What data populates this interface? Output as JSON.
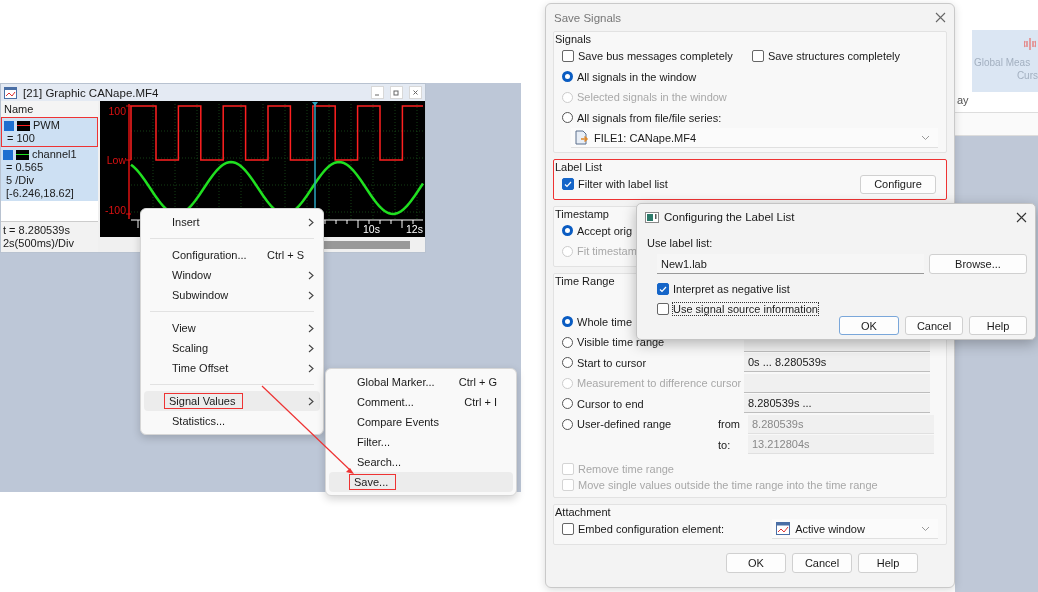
{
  "graphic_window": {
    "title": "[21] Graphic CANape.MF4",
    "column_header": "Name",
    "signals": [
      {
        "name": "PWM",
        "value": "= 100",
        "checked": true,
        "color": "#ff2020",
        "annotated": true
      },
      {
        "name": "channel1",
        "value": "= 0.565",
        "checked": true,
        "color": "#20e020",
        "annotated": false,
        "details": [
          "5  /Div",
          "[-6.246,18.62]"
        ]
      }
    ],
    "y_labels": [
      "100",
      "Low",
      "-100"
    ],
    "x_labels": [
      "10s",
      "12s"
    ],
    "status": [
      "t = 8.280539s",
      "2s(500ms)/Div"
    ]
  },
  "context_menu": {
    "groups": [
      [
        {
          "label": "Insert",
          "submenu": true,
          "highlighted": false,
          "annotated": false
        }
      ],
      [
        {
          "label": "Configuration...",
          "shortcut": "Ctrl + S",
          "submenu": false,
          "highlighted": false,
          "annotated": false
        },
        {
          "label": "Window",
          "submenu": true,
          "highlighted": false,
          "annotated": false
        },
        {
          "label": "Subwindow",
          "submenu": true,
          "highlighted": false,
          "annotated": false
        }
      ],
      [
        {
          "label": "View",
          "submenu": true,
          "highlighted": false,
          "annotated": false
        },
        {
          "label": "Scaling",
          "submenu": true,
          "highlighted": false,
          "annotated": false
        },
        {
          "label": "Time Offset",
          "submenu": true,
          "highlighted": false,
          "annotated": false
        }
      ],
      [
        {
          "label": "Signal Values",
          "submenu": true,
          "highlighted": true,
          "annotated": true
        },
        {
          "label": "Statistics...",
          "submenu": false,
          "highlighted": false,
          "annotated": false
        }
      ]
    ]
  },
  "submenu": {
    "items": [
      {
        "label": "Global Marker...",
        "shortcut": "Ctrl + G",
        "highlighted": false,
        "annotated": false
      },
      {
        "label": "Comment...",
        "shortcut": "Ctrl + I",
        "highlighted": false,
        "annotated": false
      },
      {
        "label": "Compare Events",
        "highlighted": false,
        "annotated": false
      },
      {
        "label": "Filter...",
        "highlighted": false,
        "annotated": false
      },
      {
        "label": "Search...",
        "highlighted": false,
        "annotated": false
      },
      {
        "label": "Save...",
        "highlighted": true,
        "annotated": true
      }
    ]
  },
  "background_app": {
    "ribbon_button": [
      "Global Meas",
      "Curs"
    ],
    "side_label": "ay"
  },
  "save_dialog": {
    "title": "Save Signals",
    "signals": {
      "title": "Signals",
      "checkboxes": [
        {
          "label": "Save bus messages completely",
          "checked": false
        },
        {
          "label": "Save structures completely",
          "checked": false
        }
      ],
      "radios": [
        {
          "label": "All signals in the window",
          "selected": true,
          "disabled": false
        },
        {
          "label": "Selected signals in the window",
          "selected": false,
          "disabled": true
        },
        {
          "label": "All signals from file/file series:",
          "selected": false,
          "disabled": false
        }
      ],
      "file_dropdown": "FILE1: CANape.MF4"
    },
    "label_list": {
      "title": "Label List",
      "annotated": true,
      "checkbox": {
        "label": "Filter with label list",
        "checked": true
      },
      "button": "Configure"
    },
    "timestamp": {
      "title": "Timestamp",
      "radios": [
        {
          "label": "Accept orig",
          "selected": true,
          "disabled": false
        },
        {
          "label": "Fit timestam",
          "selected": false,
          "disabled": true
        }
      ]
    },
    "time_range": {
      "title": "Time Range",
      "options": [
        {
          "label": "Whole time",
          "selected": true,
          "disabled": false,
          "kind": "plain"
        },
        {
          "label": "Visible time range",
          "selected": false,
          "disabled": false,
          "kind": "field"
        },
        {
          "label": "Start to cursor",
          "selected": false,
          "disabled": false,
          "kind": "field",
          "value": "0s  ...  8.280539s"
        },
        {
          "label": "Measurement to difference cursor",
          "selected": false,
          "disabled": true,
          "kind": "field"
        },
        {
          "label": "Cursor to end",
          "selected": false,
          "disabled": false,
          "kind": "field",
          "value": "8.280539s  ..."
        },
        {
          "label": "User-defined range",
          "selected": false,
          "disabled": false,
          "kind": "range",
          "from_label": "from",
          "from_value": "8.280539s",
          "to_label": "to:",
          "to_value": "13.212804s"
        }
      ],
      "checkboxes": [
        {
          "label": "Remove time range",
          "checked": false,
          "disabled": true
        },
        {
          "label": "Move single values outside the time range into the time range",
          "checked": false,
          "disabled": true
        }
      ]
    },
    "attachment": {
      "title": "Attachment",
      "checkbox": {
        "label": "Embed configuration element:",
        "checked": false
      },
      "dropdown": "Active window"
    },
    "buttons": [
      "OK",
      "Cancel",
      "Help"
    ]
  },
  "label_dialog": {
    "title": "Configuring the Label List",
    "field_label": "Use label list:",
    "file": "New1.lab",
    "browse": "Browse...",
    "checkboxes": [
      {
        "label": "Interpret as negative list",
        "checked": true,
        "focused": false
      },
      {
        "label": "Use signal source information",
        "checked": false,
        "focused": true
      }
    ],
    "buttons": [
      {
        "label": "OK",
        "default": true
      },
      {
        "label": "Cancel",
        "default": false
      },
      {
        "label": "Help",
        "default": false
      }
    ]
  }
}
